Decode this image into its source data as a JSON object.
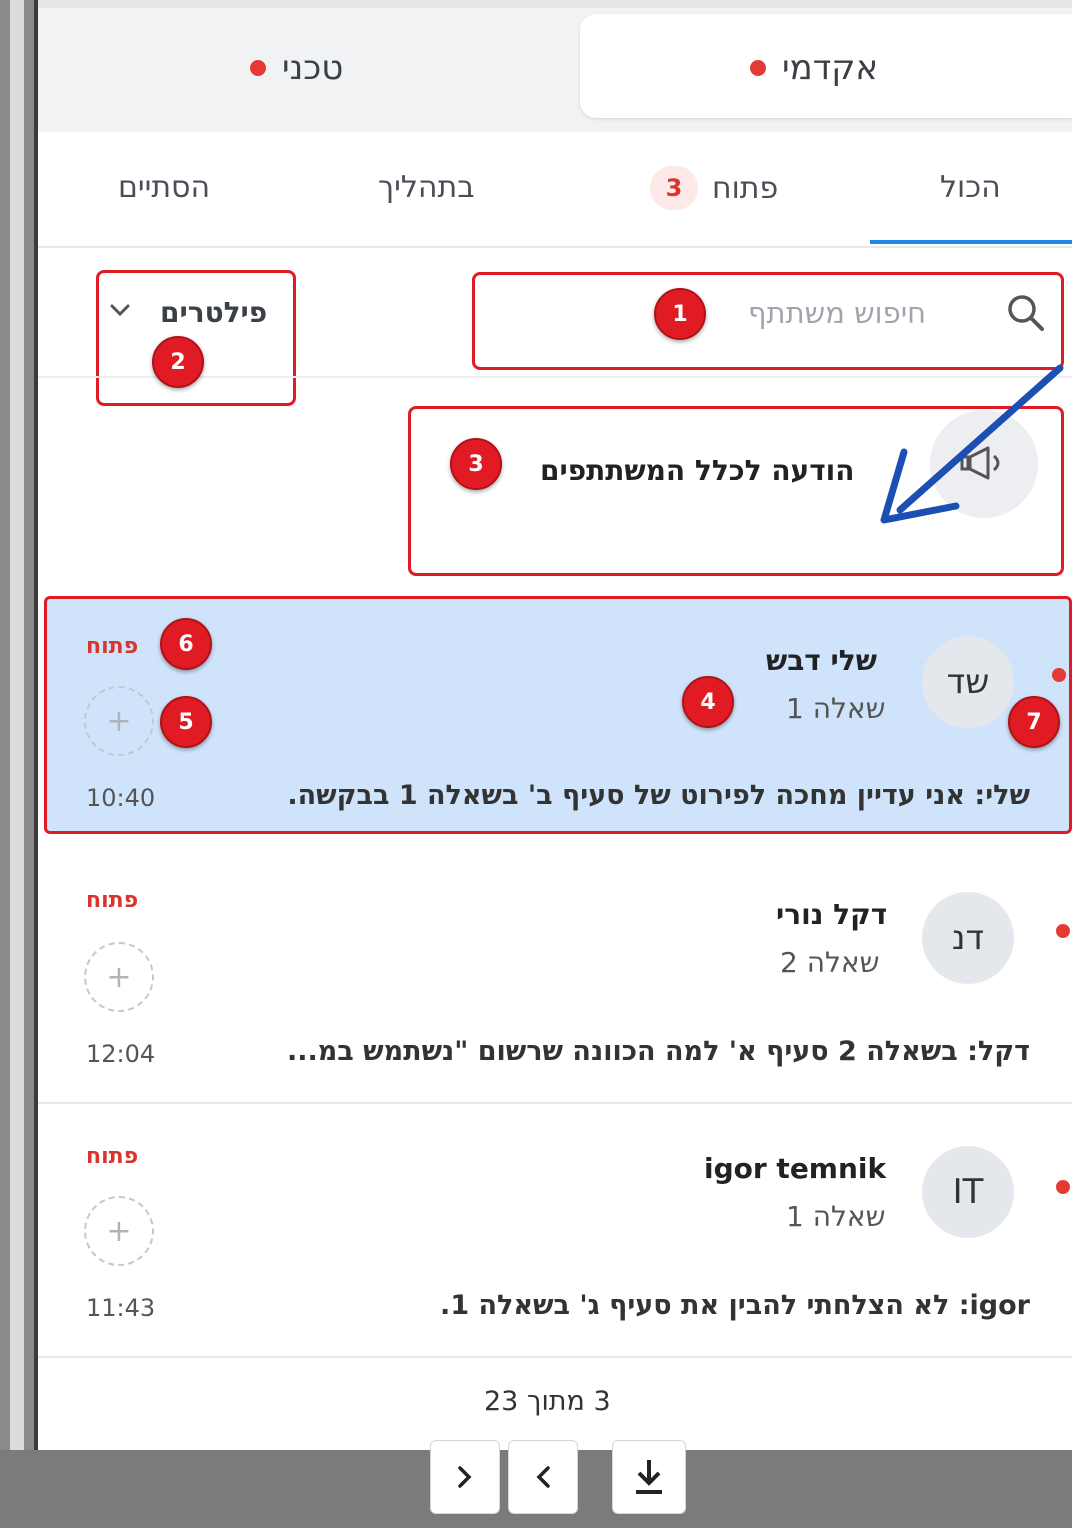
{
  "top_tabs": [
    {
      "label": "אקדמי",
      "active": true
    },
    {
      "label": "טכני",
      "active": false
    }
  ],
  "status_tabs": [
    {
      "label": "הכול",
      "active": true
    },
    {
      "label": "פתוח",
      "count": "3"
    },
    {
      "label": "בתהליך"
    },
    {
      "label": "הסתיים"
    }
  ],
  "search": {
    "placeholder": "חיפוש משתתף"
  },
  "filters": {
    "label": "פילטרים"
  },
  "announcement": {
    "label": "הודעה לכלל המשתתפים"
  },
  "conversations": [
    {
      "initials": "שד",
      "name": "שלי דבש",
      "question": "שאלה 1",
      "status": "פתוח",
      "message": "שלי: אני עדיין מחכה לפירוט של סעיף ב' בשאלה 1 בבקשה.",
      "time": "10:40",
      "selected": true
    },
    {
      "initials": "דנ",
      "name": "דקל נורי",
      "question": "שאלה 2",
      "status": "פתוח",
      "message": "דקל: בשאלה 2 סעיף א' למה הכוונה שרשום \"נשתמש במ...",
      "time": "12:04",
      "selected": false
    },
    {
      "initials": "IT",
      "name": "igor temnik",
      "question": "שאלה 1",
      "status": "פתוח",
      "message": "igor: לא הצלחתי להבין את סעיף ג' בשאלה 1.",
      "time": "11:43",
      "selected": false
    }
  ],
  "pagination": {
    "text": "3 מתוך 23"
  },
  "annotations": [
    "1",
    "2",
    "3",
    "4",
    "5",
    "6",
    "7"
  ],
  "colors": {
    "annotation_red": "#e01b24",
    "accent_blue": "#1e88e5",
    "selected_bg": "#cfe4fb",
    "status_red": "#d9352f"
  },
  "icons": [
    "search-icon",
    "chevron-down-icon",
    "megaphone-icon",
    "plus-icon",
    "download-icon",
    "chevron-left-icon",
    "chevron-right-icon"
  ]
}
